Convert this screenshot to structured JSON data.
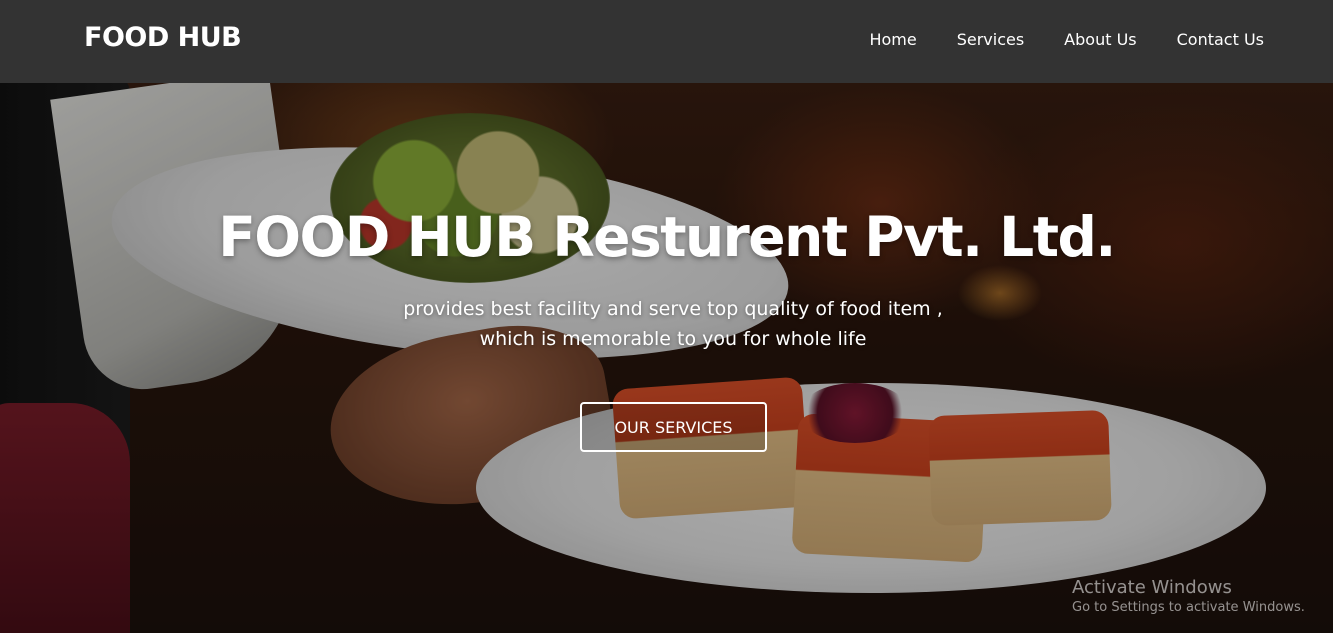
{
  "header": {
    "brand": "FOOD HUB",
    "nav": [
      {
        "label": "Home"
      },
      {
        "label": "Services"
      },
      {
        "label": "About Us"
      },
      {
        "label": "Contact Us"
      }
    ]
  },
  "hero": {
    "title": "FOOD HUB Resturent Pvt. Ltd.",
    "subtitle_line1": "provides best facility and serve top quality of food item ,",
    "subtitle_line2": "which is memorable to you for whole life",
    "cta_label": "OUR SERVICES"
  },
  "watermark": {
    "title": "Activate Windows",
    "subtitle": "Go to Settings to activate Windows."
  },
  "colors": {
    "navbar_bg": "#333333",
    "text": "#ffffff"
  }
}
